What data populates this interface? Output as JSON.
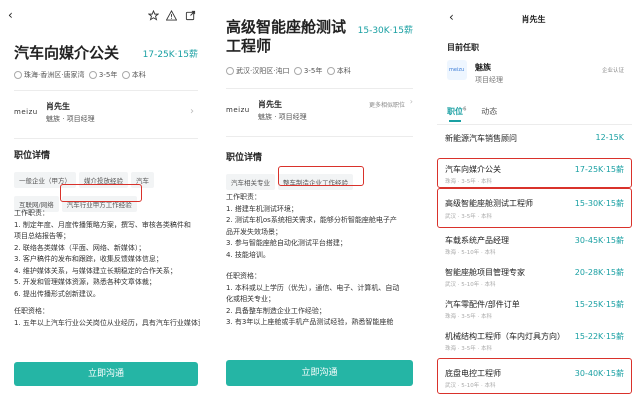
{
  "panel1": {
    "title": "汽车向媒介公关",
    "salary": "17-25K·15薪",
    "location": "珠海·香洲区·唐家湾",
    "experience": "3-5年",
    "education": "本科",
    "recruiter_name": "肖先生",
    "recruiter_company_role": "魅族 · 项目经理",
    "company_logo_text": "meizu",
    "section_title": "职位详情",
    "tags": [
      "一般企业（甲方）",
      "媒介投放经验",
      "汽车",
      "互联网/网络",
      "汽车行业甲方工作经验"
    ],
    "duties_title": "工作职责：",
    "duties": [
      "1. 制定年度、月度传播策略方案，撰写、审核各类稿件和",
      "项目总结报告等；",
      "2. 联络各类媒体（平面、网络、新媒体）；",
      "3. 客户稿件的发布和跟踪，收集反馈媒体信息；",
      "4. 维护媒体关系，与媒体建立长期稳定的合作关系；",
      "5. 开发和管理媒体资源，熟悉各种文章体裁；",
      "6. 提出传播形式创新建议。"
    ],
    "req_title": "任职资格：",
    "req_first": "1. 五年以上汽车行业公关岗位从业经历，具有汽车行业媒体资源；",
    "button": "立即沟通"
  },
  "panel2": {
    "title_line1": "高级智能座舱测试",
    "title_line2": "工程师",
    "salary": "15-30K·15薪",
    "location": "武汉·汉阳区·沌口",
    "experience": "3-5年",
    "education": "本科",
    "recruiter_name": "肖先生",
    "recruiter_company_role": "魅族 · 项目经理",
    "company_logo_text": "meizu",
    "more_link": "更多相似职位",
    "section_title": "职位详情",
    "tags": [
      "汽车相关专业",
      "整车制造企业工作经验"
    ],
    "duties_title": "工作职责：",
    "duties": [
      "1. 搭建车机测试环境；",
      "2. 测试车机os系统相关需求，能够分析智能座舱电子产",
      "品开发失效场景；",
      "3. 参与智能座舱自动化测试平台搭建；",
      "4. 技能培训。"
    ],
    "req_title": "任职资格：",
    "reqs": [
      "1. 本科或以上学历（优先），通信、电子、计算机、自动",
      "化或相关专业；",
      "2. 具备整车制造企业工作经验；",
      "3. 有3年以上座舱或手机产品测试经验，熟悉智能座舱"
    ],
    "button": "立即沟通"
  },
  "panel3": {
    "name": "肖先生",
    "current_job_title": "目前任职",
    "company_logo_text": "meizu",
    "company": "魅族",
    "role": "项目经理",
    "verified": "企业认证",
    "tab_jobs": "职位",
    "tab_jobs_count": "6",
    "tab_activity": "动态",
    "jobs": [
      {
        "title": "新能源汽车销售顾问",
        "salary": "12-15K",
        "sub": "",
        "highlight": false
      },
      {
        "title": "汽车向媒介公关",
        "salary": "17-25K·15薪",
        "sub": "珠海 · 3-5年 · 本科",
        "highlight": true
      },
      {
        "title": "高级智能座舱测试工程师",
        "salary": "15-30K·15薪",
        "sub": "武汉 · 3-5年 · 本科",
        "highlight": true
      },
      {
        "title": "车载系统产品经理",
        "salary": "30-45K·15薪",
        "sub": "珠海 · 5-10年 · 本科",
        "highlight": false
      },
      {
        "title": "智能座舱项目管理专家",
        "salary": "20-28K·15薪",
        "sub": "武汉 · 5-10年 · 本科",
        "highlight": false
      },
      {
        "title": "汽车零配件/部件订单",
        "salary": "15-25K·15薪",
        "sub": "珠海 · 3-5年 · 本科",
        "highlight": false
      },
      {
        "title": "机械结构工程师（车内灯具方向）",
        "salary": "15-22K·15薪",
        "sub": "珠海 · 3-5年 · 本科",
        "highlight": false
      },
      {
        "title": "底盘电控工程师",
        "salary": "30-40K·15薪",
        "sub": "武汉 · 5-10年 · 本科",
        "highlight": true
      }
    ]
  }
}
